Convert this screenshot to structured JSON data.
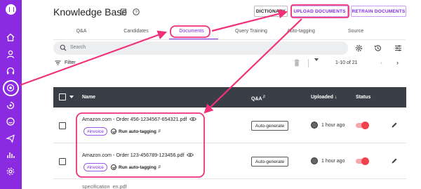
{
  "header": {
    "title": "Knowledge Base",
    "buttons": {
      "dictionary": "DICTIONARY",
      "upload": "UPLOAD DOCUMENTS",
      "retrain": "RETRAIN DOCUMENTS"
    }
  },
  "tabs": [
    {
      "label": "Q&A"
    },
    {
      "label": "Candidates"
    },
    {
      "label": "Documents",
      "active": true
    },
    {
      "label": "Query Training"
    },
    {
      "label": "Auto-tagging"
    },
    {
      "label": "Source"
    }
  ],
  "search": {
    "placeholder": "Search"
  },
  "toolbar": {
    "filter_label": "Filter",
    "per_page": "10",
    "page_range": "1-10 of 21"
  },
  "table": {
    "columns": {
      "name": "Name",
      "qa": "Q&A",
      "uploaded": "Uploaded",
      "status": "Status"
    },
    "rows": [
      {
        "name": "Amazon.com - Order 456-1234567-654321.pdf",
        "tag": "#invoice",
        "autotag": "Run auto-tagging",
        "qa_action": "Auto-generate",
        "uploaded": "1 hour ago"
      },
      {
        "name": "Amazon.com - Order 123-456789-123456.pdf",
        "tag": "#invoice",
        "autotag": "Run auto-tagging",
        "qa_action": "Auto-generate",
        "uploaded": "1 hour ago"
      },
      {
        "name": "specification_en.pdf"
      }
    ]
  },
  "colors": {
    "accent": "#7b2be2",
    "sidebar": "#8a2be2",
    "annotation": "#f0317a",
    "toggle_on": "#f0424c",
    "table_header": "#3a3f47"
  },
  "icons": {
    "sidebar": [
      "logo-icon",
      "home-icon",
      "user-icon",
      "headset-icon",
      "knowledge-base-icon",
      "tag-icon",
      "chat-icon",
      "send-icon",
      "analytics-icon",
      "settings-icon"
    ],
    "toolbar": [
      "settings-icon",
      "history-icon",
      "tune-icon"
    ]
  }
}
